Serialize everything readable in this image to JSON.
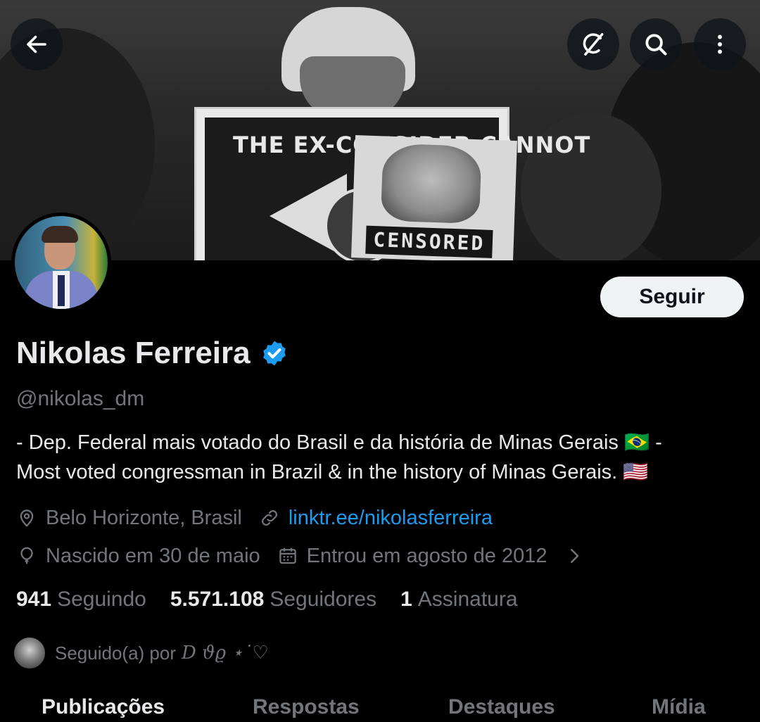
{
  "banner": {
    "sign_text": "THE EX-CONSIDER CANNOT",
    "photo_text": "CENSORED"
  },
  "header_actions": {
    "back_icon": "arrow-left-icon",
    "grok_icon": "grok-icon",
    "search_icon": "search-icon",
    "more_icon": "more-vertical-icon"
  },
  "profile": {
    "name": "Nikolas Ferreira",
    "verified": true,
    "verified_color": "#1d9bf0",
    "handle": "@nikolas_dm",
    "bio_line_1": "- Dep. Federal mais votado do Brasil e da história de Minas Gerais 🇧🇷 -",
    "bio_line_2": "Most voted congressman in Brazil & in the history of Minas Gerais. 🇺🇸",
    "location": "Belo Horizonte, Brasil",
    "website": "linktr.ee/nikolasferreira",
    "birthday": "Nascido em 30 de maio",
    "joined": "Entrou em agosto de 2012"
  },
  "follow_button": {
    "label": "Seguir"
  },
  "stats": {
    "following_count": "941",
    "following_label": "Seguindo",
    "followers_count": "5.571.108",
    "followers_label": "Seguidores",
    "subscriptions_count": "1",
    "subscriptions_label": "Assinatura"
  },
  "followed_by": {
    "prefix": "Seguido(a) por",
    "name": "𝐷 𝜗𝜚 ⋆˙♡"
  },
  "tabs": [
    {
      "label": "Publicações",
      "active": true
    },
    {
      "label": "Respostas",
      "active": false
    },
    {
      "label": "Destaques",
      "active": false
    },
    {
      "label": "Mídia",
      "active": false
    }
  ],
  "colors": {
    "background": "#000000",
    "text_primary": "#e7e9ea",
    "text_secondary": "#71767b",
    "link": "#1d9bf0",
    "button_bg": "#eff3f4"
  }
}
